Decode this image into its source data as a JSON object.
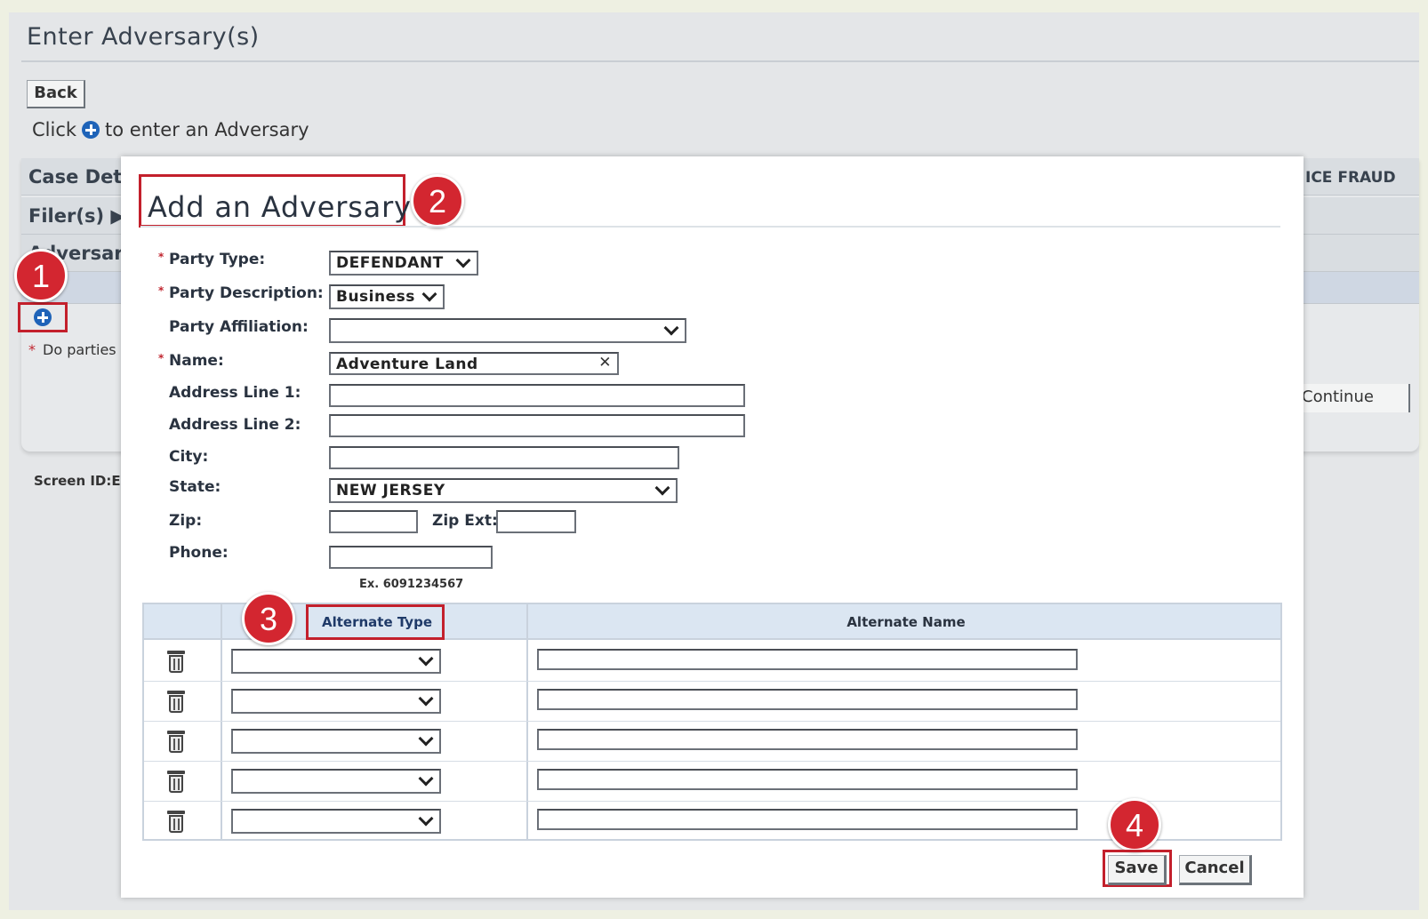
{
  "page": {
    "title": "Enter Adversary(s)",
    "back_label": "Back",
    "instruction_prefix": "Click",
    "instruction_suffix": "to enter an Adversary",
    "rows": {
      "case_details": "Case Deta",
      "filers": "Filer(s) ▶",
      "adversary": "Adversary"
    },
    "right_header_text": "ICE FRAUD",
    "note": "Do parties",
    "continue_label": "Continue",
    "screen_id": "Screen ID:E"
  },
  "callouts": [
    "1",
    "2",
    "3",
    "4"
  ],
  "modal": {
    "title": "Add an Adversary",
    "fields": {
      "party_type": {
        "label": "Party Type:",
        "value": "DEFENDANT",
        "required": true
      },
      "party_description": {
        "label": "Party Description:",
        "value": "Business",
        "required": true
      },
      "party_affiliation": {
        "label": "Party Affiliation:",
        "value": ""
      },
      "name": {
        "label": "Name:",
        "value": "Adventure Land",
        "required": true
      },
      "address1": {
        "label": "Address Line 1:",
        "value": ""
      },
      "address2": {
        "label": "Address Line 2:",
        "value": ""
      },
      "city": {
        "label": "City:",
        "value": ""
      },
      "state": {
        "label": "State:",
        "value": "NEW JERSEY"
      },
      "zip": {
        "label": "Zip:",
        "value": ""
      },
      "zip_ext": {
        "label": "Zip Ext:",
        "value": ""
      },
      "phone": {
        "label": "Phone:",
        "value": "",
        "hint": "Ex. 6091234567"
      }
    },
    "alternate_table": {
      "headers": [
        "Alternate Type",
        "Alternate Name"
      ],
      "rows": [
        {
          "type": "",
          "name": ""
        },
        {
          "type": "",
          "name": ""
        },
        {
          "type": "",
          "name": ""
        },
        {
          "type": "",
          "name": ""
        },
        {
          "type": "",
          "name": ""
        }
      ]
    },
    "save_label": "Save",
    "cancel_label": "Cancel"
  },
  "colors": {
    "accent_red": "#d32630",
    "link_blue": "#1e63b8",
    "table_header": "#dbe6f2"
  }
}
